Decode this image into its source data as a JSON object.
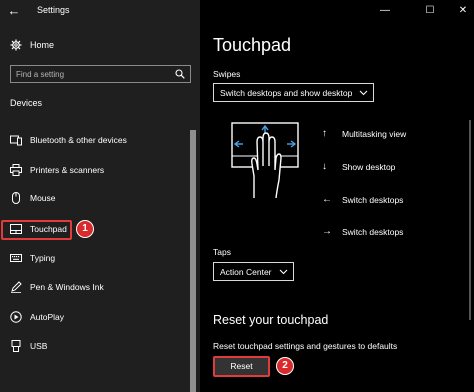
{
  "app": {
    "title": "Settings"
  },
  "window": {
    "minimize_glyph": "—",
    "maximize_glyph": "☐",
    "close_glyph": "✕"
  },
  "sidebar": {
    "home_label": "Home",
    "search_placeholder": "Find a setting",
    "section_heading": "Devices",
    "items": [
      {
        "label": "Bluetooth & other devices",
        "icon": "bluetooth-devices-icon"
      },
      {
        "label": "Printers & scanners",
        "icon": "printer-icon"
      },
      {
        "label": "Mouse",
        "icon": "mouse-icon"
      },
      {
        "label": "Touchpad",
        "icon": "touchpad-icon",
        "active": true
      },
      {
        "label": "Typing",
        "icon": "keyboard-icon"
      },
      {
        "label": "Pen & Windows Ink",
        "icon": "pen-icon"
      },
      {
        "label": "AutoPlay",
        "icon": "autoplay-icon"
      },
      {
        "label": "USB",
        "icon": "usb-icon"
      }
    ]
  },
  "annotations": {
    "badge_1": "1",
    "badge_2": "2",
    "highlight_color": "#e23b3b"
  },
  "main": {
    "page_title": "Touchpad",
    "swipes": {
      "label": "Swipes",
      "selected": "Switch desktops and show desktop"
    },
    "gestures": [
      {
        "direction": "up",
        "arrow": "↑",
        "label": "Multitasking view"
      },
      {
        "direction": "down",
        "arrow": "↓",
        "label": "Show desktop"
      },
      {
        "direction": "left",
        "arrow": "←",
        "label": "Switch desktops"
      },
      {
        "direction": "right",
        "arrow": "→",
        "label": "Switch desktops"
      }
    ],
    "taps": {
      "label": "Taps",
      "selected": "Action Center"
    },
    "reset": {
      "title": "Reset your touchpad",
      "description": "Reset touchpad settings and gestures to defaults",
      "button_label": "Reset"
    }
  },
  "colors": {
    "sidebar_bg": "#1f1f1f",
    "main_bg": "#000000",
    "accent": "#4aa3e8",
    "highlight": "#e23b3b"
  }
}
